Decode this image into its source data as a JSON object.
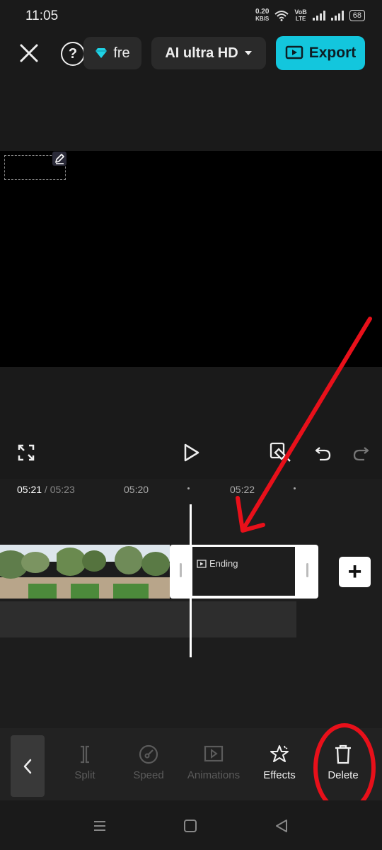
{
  "status_bar": {
    "time": "11:05",
    "net_speed_value": "0.20",
    "net_speed_unit": "KB/S",
    "volte_top": "VoB",
    "volte_bottom": "LTE",
    "battery": "68"
  },
  "top_bar": {
    "pro_label": "fre",
    "quality_label": "AI ultra HD",
    "export_label": "Export"
  },
  "timeline": {
    "current_time": "05:21",
    "separator": " / ",
    "total_time": "05:23",
    "ruler_marks": [
      "05:20",
      "05:22"
    ],
    "ending_clip_label": "Ending"
  },
  "toolbar": {
    "items": [
      {
        "label": "Split",
        "icon": "split-icon",
        "enabled": false
      },
      {
        "label": "Speed",
        "icon": "speed-icon",
        "enabled": false
      },
      {
        "label": "Animations",
        "icon": "animations-icon",
        "enabled": false
      },
      {
        "label": "Effects",
        "icon": "effects-icon",
        "enabled": true
      },
      {
        "label": "Delete",
        "icon": "trash-icon",
        "enabled": true
      }
    ]
  },
  "colors": {
    "accent": "#13c6dd",
    "annotation": "#e8101a",
    "background": "#1a1a1a"
  }
}
